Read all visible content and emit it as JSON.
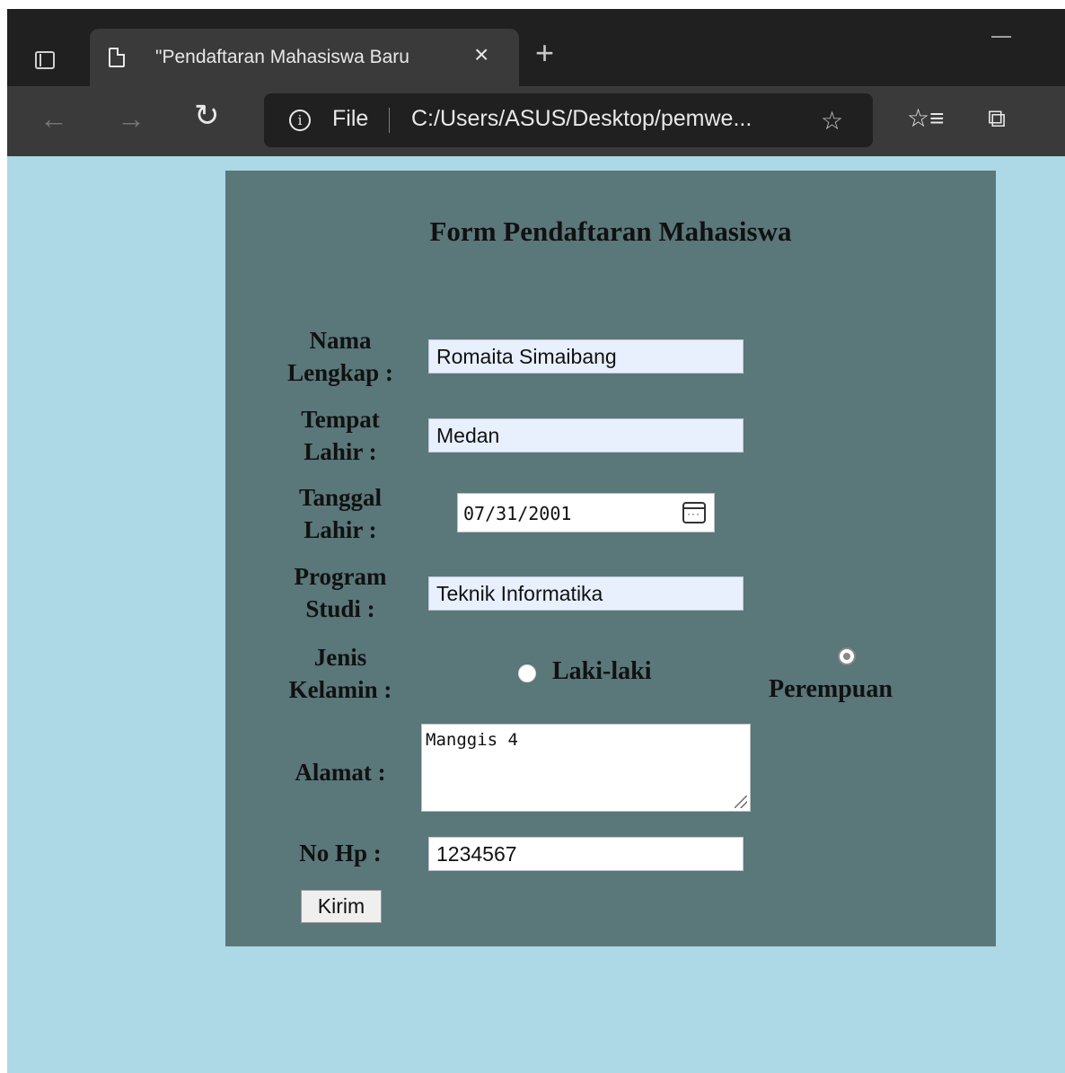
{
  "browser": {
    "tab_title": "\"Pendaftaran Mahasiswa Baru",
    "tab_close": "×",
    "new_tab": "+",
    "address": {
      "security_label": "File",
      "url": "C:/Users/ASUS/Desktop/pemwe..."
    },
    "icons": {
      "back": "←",
      "forward": "→",
      "reload": "↻",
      "info": "i",
      "add_favorite": "☆",
      "favorites": "☆≡",
      "collections": "⧉"
    }
  },
  "form": {
    "title": "Form Pendaftaran Mahasiswa",
    "nama": {
      "label_line1": "Nama",
      "label_line2": "Lengkap :",
      "value": "Romaita Simaibang"
    },
    "tempat": {
      "label_line1": "Tempat",
      "label_line2": "Lahir :",
      "value": "Medan"
    },
    "tanggal": {
      "label_line1": "Tanggal",
      "label_line2": "Lahir :",
      "value": "07/31/2001"
    },
    "prodi": {
      "label_line1": "Program",
      "label_line2": "Studi :",
      "value": "Teknik Informatika"
    },
    "jenis_kelamin": {
      "label_line1": "Jenis",
      "label_line2": "Kelamin :",
      "options": [
        "Laki-laki",
        "Perempuan"
      ],
      "selected": "Perempuan"
    },
    "alamat": {
      "label": "Alamat :",
      "value": "Manggis 4"
    },
    "no_hp": {
      "label": "No Hp :",
      "value": "1234567"
    },
    "submit_label": "Kirim"
  },
  "colors": {
    "page_background": "#add8e6",
    "form_background": "#5a777a",
    "autofill_background": "#e8f0fe"
  }
}
